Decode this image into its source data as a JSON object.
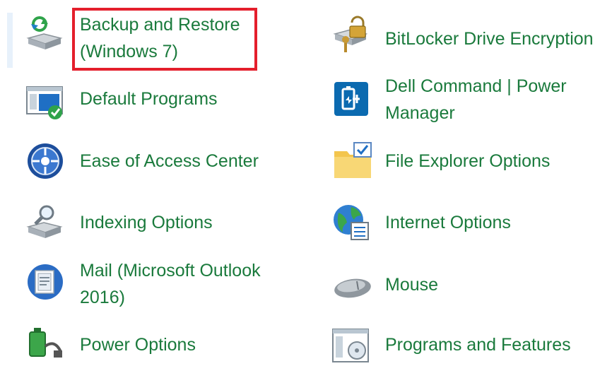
{
  "items": [
    {
      "id": "backup",
      "line1": "Backup and Restore",
      "line2": "(Windows 7)"
    },
    {
      "id": "bitlocker",
      "line1": "BitLocker Drive Encryption"
    },
    {
      "id": "default",
      "line1": "Default Programs"
    },
    {
      "id": "dell",
      "line1": "Dell Command | Power",
      "line2": "Manager"
    },
    {
      "id": "ease",
      "line1": "Ease of Access Center"
    },
    {
      "id": "fileexplorer",
      "line1": "File Explorer Options"
    },
    {
      "id": "indexing",
      "line1": "Indexing Options"
    },
    {
      "id": "internet",
      "line1": "Internet Options"
    },
    {
      "id": "mail",
      "line1": "Mail (Microsoft Outlook",
      "line2": "2016)"
    },
    {
      "id": "mouse",
      "line1": "Mouse"
    },
    {
      "id": "power",
      "line1": "Power Options"
    },
    {
      "id": "programs",
      "line1": "Programs and Features"
    }
  ],
  "colors": {
    "link": "#1a7a3c",
    "highlight": "#e41f2c",
    "hover": "#e7f1fb"
  }
}
